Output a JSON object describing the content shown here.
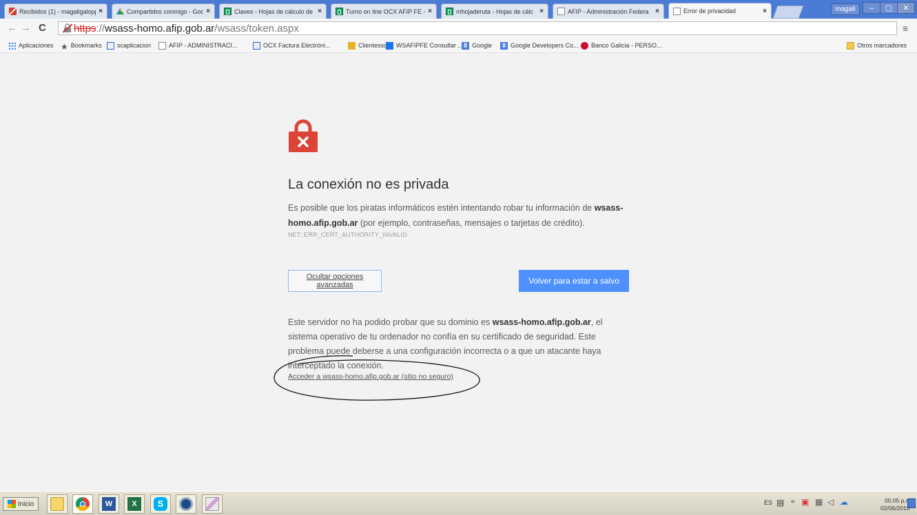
{
  "tabs": [
    {
      "title": "Recibidos (1) - magaligalopp",
      "icon": "gmail"
    },
    {
      "title": "Compartidos conmigo - Goog",
      "icon": "drive"
    },
    {
      "title": "Claves - Hojas de cálculo de",
      "icon": "sheets"
    },
    {
      "title": "Turno on line OCX AFIP FE -",
      "icon": "sheets"
    },
    {
      "title": "mhojaderuta - Hojas de cálc",
      "icon": "sheets"
    },
    {
      "title": "AFIP - Administración Federa",
      "icon": "page"
    },
    {
      "title": "Error de privacidad",
      "icon": "page",
      "active": true
    }
  ],
  "window": {
    "user": "magali",
    "minimize": "–",
    "restore": "▢",
    "close": "✕"
  },
  "omnibox": {
    "scheme": "https",
    "separator": "://",
    "host": "wsass-homo.afip.gob.ar",
    "path": "/wsass/token.aspx",
    "security": "not-secure"
  },
  "bookmarks": [
    {
      "label": "Aplicaciones",
      "icon": "apps"
    },
    {
      "label": "Bookmarks",
      "icon": "star"
    },
    {
      "label": "scaplicacion",
      "icon": "sheet"
    },
    {
      "label": "AFIP - ADMINISTRACI...",
      "icon": "page"
    },
    {
      "label": "OCX Factura Electróni...",
      "icon": "sheet"
    },
    {
      "label": "Clientessc",
      "icon": "folder-yellow"
    },
    {
      "label": "WSAFIPFE Consultar ...",
      "icon": "arrow"
    },
    {
      "label": "Google",
      "icon": "google"
    },
    {
      "label": "Google Developers Co...",
      "icon": "google"
    },
    {
      "label": "Banco Galicia - PERSO...",
      "icon": "galicia"
    }
  ],
  "other_bookmarks": "Otros marcadores",
  "interstitial": {
    "title": "La conexión no es privada",
    "message_prefix": "Es posible que los piratas informáticos estén intentando robar tu información de ",
    "message_host": "wsass-homo.afip.gob.ar",
    "message_suffix": " (por ejemplo, contraseñas, mensajes o tarjetas de crédito).",
    "error_code": "NET::ERR_CERT_AUTHORITY_INVALID",
    "advanced_button": "Ocultar opciones avanzadas",
    "back_button": "Volver para estar a salvo",
    "details_prefix": "Este servidor no ha podido probar que su dominio es ",
    "details_host": "wsass-homo.afip.gob.ar",
    "details_suffix": ", el sistema operativo de tu ordenador no confía en su certificado de seguridad. Este problema puede deberse a una configuración incorrecta o a que un atacante haya interceptado la conexión.",
    "proceed_link": "Acceder a wsass-homo.afip.gob.ar (sitio no seguro)",
    "accent_color": "#4d90fe",
    "lock_color": "#db4437"
  },
  "taskbar": {
    "start_label": "Inicio",
    "apps": [
      "folder",
      "chrome",
      "word",
      "excel",
      "skype",
      "steam",
      "paint"
    ],
    "language": "ES",
    "time": "05:05 p.m.",
    "date": "02/06/2015"
  }
}
